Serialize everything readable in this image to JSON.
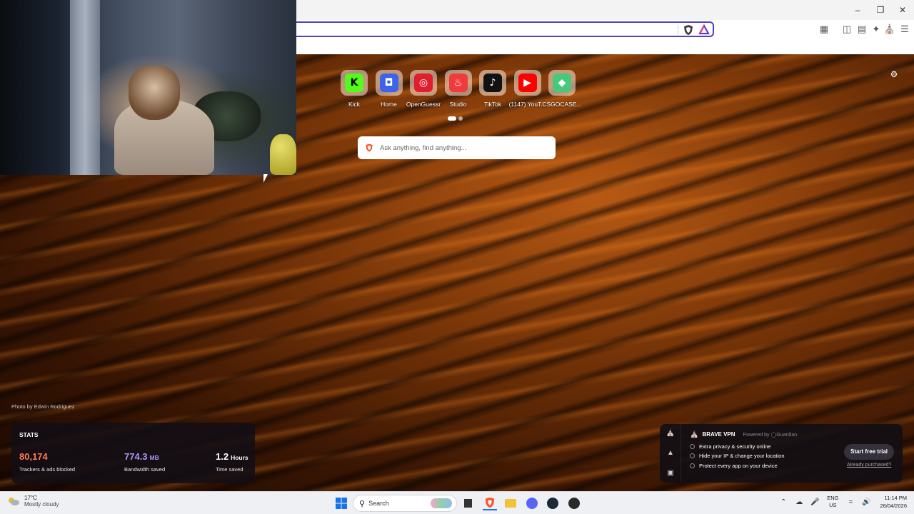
{
  "newtab": {
    "shortcuts": [
      {
        "label": "Kick",
        "icon": "kick-icon",
        "color": "#53fc18",
        "glyph": "K",
        "glyph_color": "#000000"
      },
      {
        "label": "Home",
        "icon": "home-icon",
        "color": "#3d63ea",
        "glyph": "◘",
        "glyph_color": "#ffffff"
      },
      {
        "label": "OpenGuessr",
        "icon": "openguessr-icon",
        "color": "#e11d2e",
        "glyph": "◎",
        "glyph_color": "#ffffff"
      },
      {
        "label": "Studio",
        "icon": "studio-icon",
        "color": "#ef3b3b",
        "glyph": "♨",
        "glyph_color": "#ffffff"
      },
      {
        "label": "TikTok",
        "icon": "tiktok-icon",
        "color": "#111111",
        "glyph": "♪",
        "glyph_color": "#ffffff"
      },
      {
        "label": "(1147) YouT...",
        "icon": "youtube-icon",
        "color": "#ff0000",
        "glyph": "▶",
        "glyph_color": "#ffffff"
      },
      {
        "label": "CSGOCASE...",
        "icon": "csgocase-icon",
        "color": "#47c97a",
        "glyph": "◆",
        "glyph_color": "#ffffff"
      }
    ],
    "search_placeholder": "Ask anything, find anything...",
    "photo_credit": "Photo by Edwin Rodriguez"
  },
  "stats": {
    "title": "STATS",
    "trackers_value": "80,174",
    "trackers_caption": "Trackers & ads blocked",
    "bandwidth_value": "774.3",
    "bandwidth_unit": "MB",
    "bandwidth_caption": "Bandwidth saved",
    "time_value": "1.2",
    "time_unit": "Hours",
    "time_caption": "Time saved",
    "colors": {
      "trackers": "#ff7a59",
      "bandwidth": "#a996ff",
      "time": "#ffffff"
    }
  },
  "vpn": {
    "title": "BRAVE VPN",
    "powered_by": "Powered by",
    "guardian": "Guardian",
    "features": [
      "Extra privacy & security online",
      "Hide your IP & change your location",
      "Protect every app on your device"
    ],
    "cta_label": "Start free trial",
    "already_label": "Already purchased?"
  },
  "taskbar": {
    "weather_temp": "17°C",
    "weather_desc": "Mostly cloudy",
    "search_label": "Search",
    "lang_line1": "ENG",
    "lang_line2": "US",
    "time": "11:14 PM",
    "date": "26/04/2026"
  }
}
